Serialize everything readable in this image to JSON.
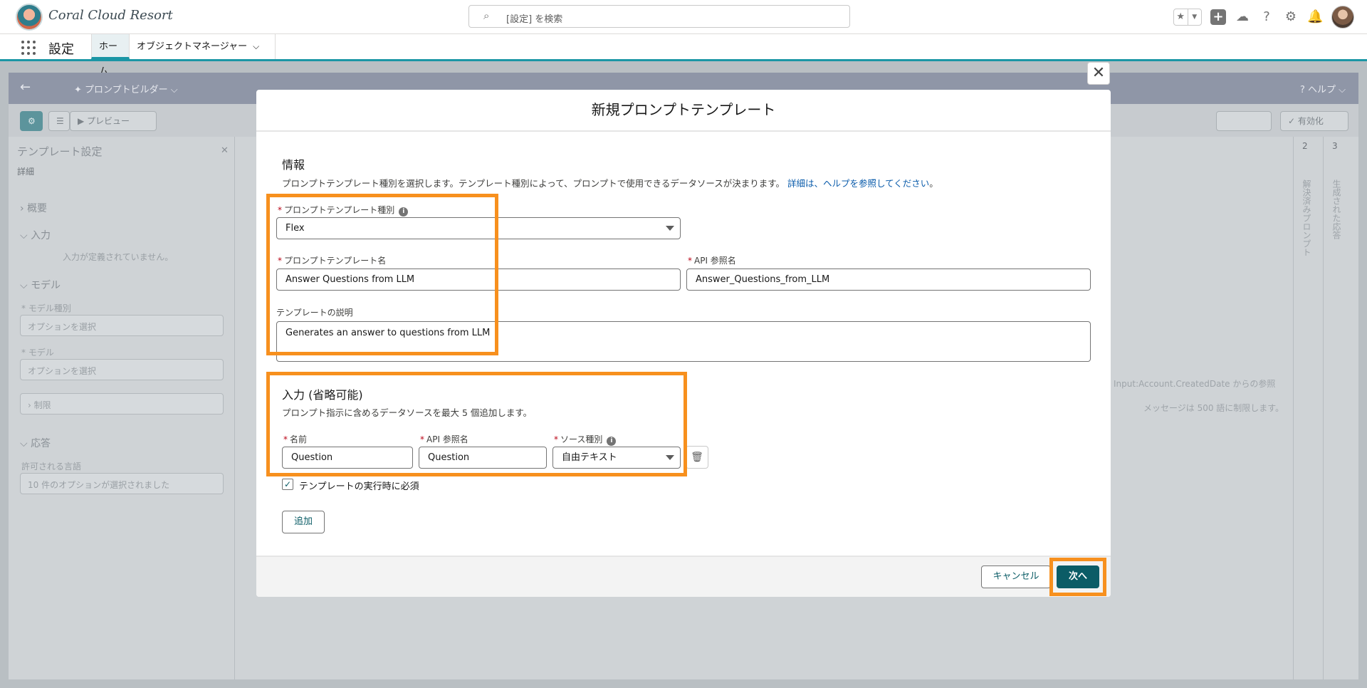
{
  "header": {
    "brand": "Coral Cloud Resort",
    "search_placeholder": "[設定] を検索"
  },
  "context_bar": {
    "app_name": "設定",
    "tab_home": "ホーム",
    "tab_object_manager": "オブジェクトマネージャー"
  },
  "background": {
    "banner_title": "プロンプトビルダー",
    "help": "ヘルプ",
    "preview": "プレビュー",
    "activate": "有効化",
    "panel_title": "テンプレート設定",
    "panel_tab": "詳細",
    "section_overview": "概要",
    "section_input": "入力",
    "input_empty": "入力が定義されていません。",
    "section_model": "モデル",
    "model_type_label": "モデル種別",
    "select_option": "オプションを選択",
    "model_label": "モデル",
    "limits": "制限",
    "section_response": "応答",
    "allowed_languages_label": "許可される言語",
    "languages_selected": "10 件のオプションが選択されました",
    "col2_num": "2",
    "col2_label": "解決済みプロンプト",
    "col3_num": "3",
    "col3_label": "生成された応答",
    "right_text_1": "Input:Account.CreatedDate からの参照",
    "right_text_2": "メッセージは 500 語に制限します。"
  },
  "modal": {
    "title": "新規プロンプトテンプレート",
    "info": {
      "title": "情報",
      "description": "プロンプトテンプレート種別を選択します。テンプレート種別によって、プロンプトで使用できるデータソースが決まります。",
      "help_link": "詳細は、ヘルプを参照してください",
      "template_type_label": "プロンプトテンプレート種別",
      "template_type_value": "Flex",
      "template_name_label": "プロンプトテンプレート名",
      "template_name_value": "Answer Questions from LLM",
      "api_name_label": "API 参照名",
      "api_name_value": "Answer_Questions_from_LLM",
      "description_label": "テンプレートの説明",
      "description_value": "Generates an answer to questions from LLM"
    },
    "inputs": {
      "title": "入力 (省略可能)",
      "description": "プロンプト指示に含めるデータソースを最大 5 個追加します。",
      "name_label": "名前",
      "name_value": "Question",
      "api_name_label": "API 参照名",
      "api_name_value": "Question",
      "source_type_label": "ソース種別",
      "source_type_value": "自由テキスト",
      "required_label": "テンプレートの実行時に必須",
      "required_checked": true,
      "add_label": "追加"
    },
    "footer": {
      "cancel": "キャンセル",
      "next": "次へ"
    }
  },
  "colors": {
    "brand": "#0b5c66",
    "highlight": "#f7901e",
    "required": "#ba0517",
    "link": "#0b5cab"
  }
}
